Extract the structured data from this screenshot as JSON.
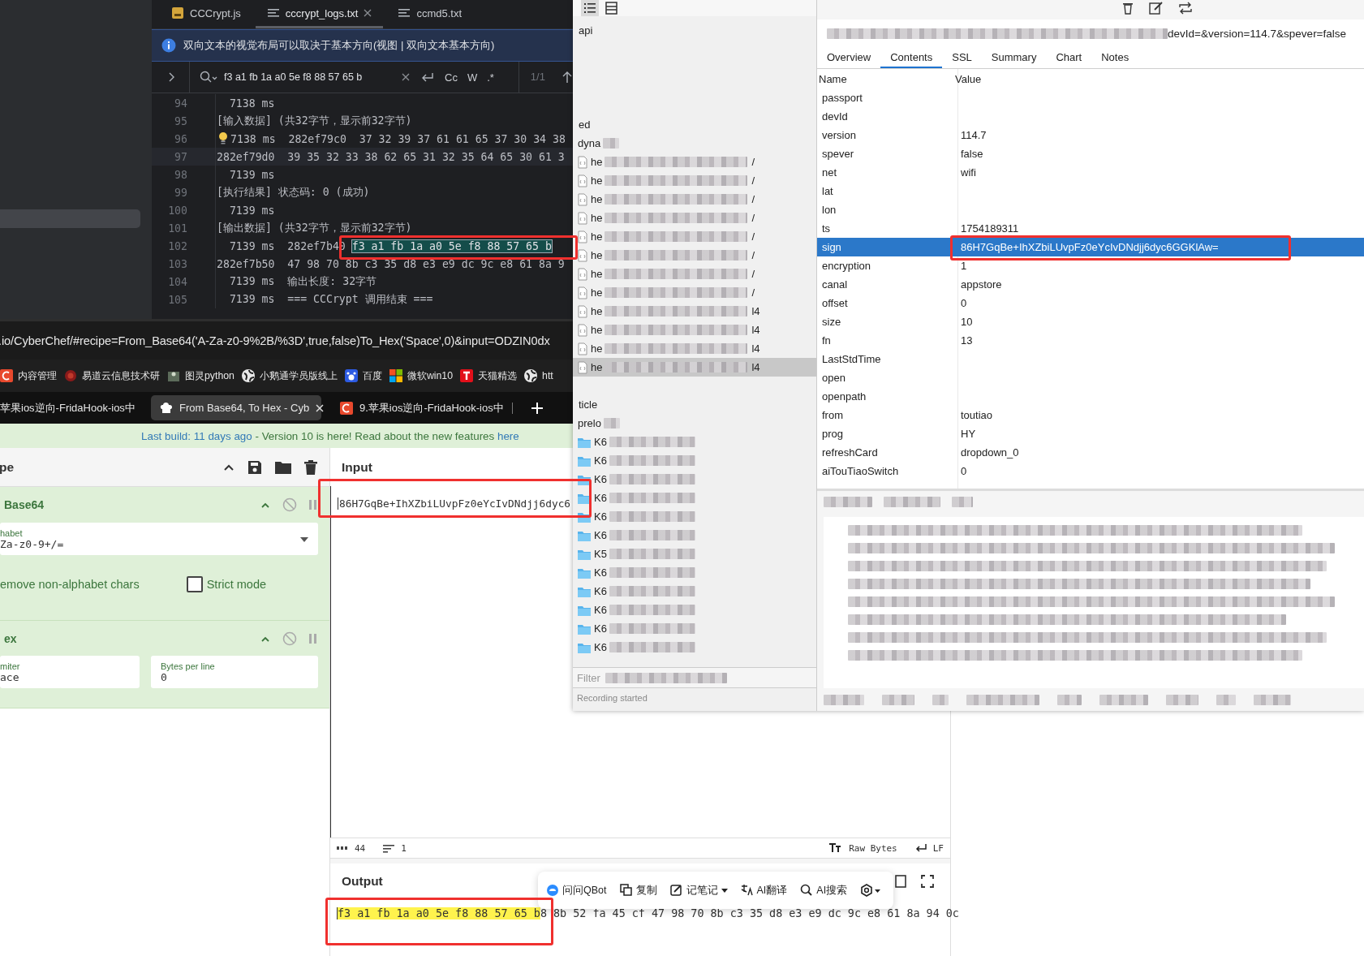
{
  "editor": {
    "tabs": [
      {
        "label": "CCCrypt.js",
        "kind": "js",
        "selected": false
      },
      {
        "label": "cccrypt_logs.txt",
        "kind": "text",
        "selected": true
      },
      {
        "label": "ccmd5.txt",
        "kind": "text",
        "selected": false
      }
    ],
    "info_bar": "双向文本的视觉布局可以取决于基本方向(视图 | 双向文本基本方向)",
    "find": {
      "value": "f3 a1 fb 1a a0 5e f8 88 57 65 b",
      "toggles": [
        "Cc",
        "W",
        ".*"
      ],
      "count": "1/1"
    },
    "lines": [
      {
        "number": "94",
        "text": "  7138 ms",
        "current": false,
        "hint": false
      },
      {
        "number": "95",
        "text": "[输入数据] (共32字节，显示前32字节)",
        "current": false,
        "hint": false
      },
      {
        "number": "96",
        "text": "7138 ms  282ef79c0  37 32 39 37 61 61 65 37 30 34 38",
        "current": false,
        "hint": true
      },
      {
        "number": "97",
        "text": "282ef79d0  39 35 32 33 38 62 65 31 32 35 64 65 30 61 3",
        "current": true,
        "hint": false
      },
      {
        "number": "98",
        "text": "  7139 ms",
        "current": false,
        "hint": false
      },
      {
        "number": "99",
        "text": "[执行结果] 状态码: 0 (成功)",
        "current": false,
        "hint": false
      },
      {
        "number": "100",
        "text": "  7139 ms",
        "current": false,
        "hint": false
      },
      {
        "number": "101",
        "text": "[输出数据] (共32字节，显示前32字节)",
        "current": false,
        "hint": false
      },
      {
        "number": "102",
        "text": "  7139 ms  282ef7b40 ",
        "match": "f3 a1 fb 1a a0 5e f8 88 57 65 b",
        "current": false,
        "hint": false
      },
      {
        "number": "103",
        "text": "282ef7b50  47 98 70 8b c3 35 d8 e3 e9 dc 9c e8 61 8a 9",
        "current": false,
        "hint": false
      },
      {
        "number": "104",
        "text": "  7139 ms  输出长度: 32字节",
        "current": false,
        "hint": false
      },
      {
        "number": "105",
        "text": "  7139 ms  === CCCrypt 调用结束 ===",
        "current": false,
        "hint": false
      }
    ]
  },
  "browser": {
    "url": ".io/CyberChef/#recipe=From_Base64('A-Za-z0-9%2B/%3D',true,false)To_Hex('Space',0)&input=ODZIN0dx",
    "bookmarks": [
      {
        "label": "内容管理",
        "kind": "c-logo"
      },
      {
        "label": "易道云信息技术研",
        "kind": "seal"
      },
      {
        "label": "图灵python",
        "kind": "figure"
      },
      {
        "label": "小鹅通学员版线上",
        "kind": "globe"
      },
      {
        "label": "百度",
        "kind": "paw"
      },
      {
        "label": "微软win10",
        "kind": "windows"
      },
      {
        "label": "天猫精选",
        "kind": "t-logo"
      },
      {
        "label": "htt",
        "kind": "globe"
      }
    ],
    "tabs": [
      {
        "label": "苹果ios逆向-FridaHook-ios中",
        "kind": "none",
        "selected": false
      },
      {
        "label": "From Base64, To Hex - Cyb",
        "kind": "chef",
        "selected": true
      },
      {
        "label": "9.苹果ios逆向-FridaHook-ios中",
        "kind": "c-logo",
        "selected": false
      }
    ],
    "banner": [
      {
        "text": "Last build: 11 days ago",
        "link": true
      },
      {
        "text": " - Version 10 is here! Read about the new features ",
        "link": false
      },
      {
        "text": "here",
        "link": true
      }
    ]
  },
  "cyberchef": {
    "recipe_title": "pe",
    "operations": [
      {
        "name": "Base64",
        "args": [
          {
            "kind": "select",
            "label": "habet",
            "value": "Za-z0-9+/="
          },
          {
            "kind": "text-only",
            "label": "emove non-alphabet chars"
          },
          {
            "kind": "checkbox",
            "label": "Strict mode",
            "checked": false
          }
        ]
      },
      {
        "name": "ex",
        "args": [
          {
            "kind": "field",
            "label": "miter",
            "value": "ace"
          },
          {
            "kind": "field",
            "label": "Bytes per line",
            "value": "0"
          }
        ]
      }
    ],
    "input": {
      "title": "Input",
      "value": "86H7GqBe+IhXZbiLUvpFz0eYcIvDNdjj6dyc6"
    },
    "status": {
      "length": "44",
      "lines": "1",
      "format": "Raw Bytes",
      "eol": "LF"
    },
    "output": {
      "title": "Output",
      "match": "f3 a1 fb 1a a0 5e f8 88 57 65 b",
      "rest": "8 8b 52 fa 45 cf 47 98 70 8b c3 35 d8 e3 e9 dc 9c e8 61 8a 94 0c"
    },
    "popup": [
      {
        "label": "问问QBot",
        "kind": "bot"
      },
      {
        "label": "复制",
        "kind": "copy"
      },
      {
        "label": "记笔记",
        "kind": "note"
      },
      {
        "label": "AI翻译",
        "kind": "translate"
      },
      {
        "label": "AI搜索",
        "kind": "search"
      }
    ]
  },
  "charles": {
    "tree": [
      {
        "label": "api",
        "kind": "group",
        "selected": false
      },
      {
        "label": "ed",
        "kind": "group",
        "selected": false
      },
      {
        "label": "dyna",
        "kind": "host",
        "selected": false
      },
      {
        "label": "he",
        "kind": "file",
        "tail": "/",
        "selected": false
      },
      {
        "label": "he",
        "kind": "file",
        "tail": "/",
        "selected": false
      },
      {
        "label": "he",
        "kind": "file",
        "tail": "/",
        "selected": false
      },
      {
        "label": "he",
        "kind": "file",
        "tail": "/",
        "selected": false
      },
      {
        "label": "he",
        "kind": "file",
        "tail": "/",
        "selected": false
      },
      {
        "label": "he",
        "kind": "file",
        "tail": "/",
        "selected": false
      },
      {
        "label": "he",
        "kind": "file",
        "tail": "/",
        "selected": false
      },
      {
        "label": "he",
        "kind": "file",
        "tail": "/",
        "selected": false
      },
      {
        "label": "he",
        "kind": "file",
        "tail": "l4",
        "selected": false
      },
      {
        "label": "he",
        "kind": "file",
        "tail": "l4",
        "selected": false
      },
      {
        "label": "he",
        "kind": "file",
        "tail": "l4",
        "selected": false
      },
      {
        "label": "he",
        "kind": "file",
        "tail": "l4",
        "selected": true
      },
      {
        "label": "ticle",
        "kind": "group",
        "selected": false
      },
      {
        "label": "prelo",
        "kind": "host",
        "selected": false
      },
      {
        "label": "K6",
        "kind": "folder",
        "selected": false
      },
      {
        "label": "K6",
        "kind": "folder",
        "selected": false
      },
      {
        "label": "K6",
        "kind": "folder",
        "selected": false
      },
      {
        "label": "K6",
        "kind": "folder",
        "selected": false
      },
      {
        "label": "K6",
        "kind": "folder",
        "selected": false
      },
      {
        "label": "K6",
        "kind": "folder",
        "selected": false
      },
      {
        "label": "K5",
        "kind": "folder",
        "selected": false
      },
      {
        "label": "K6",
        "kind": "folder",
        "selected": false
      },
      {
        "label": "K6",
        "kind": "folder",
        "selected": false
      },
      {
        "label": "K6",
        "kind": "folder",
        "selected": false
      },
      {
        "label": "K6",
        "kind": "folder",
        "selected": false
      },
      {
        "label": "K6",
        "kind": "folder",
        "selected": false
      }
    ],
    "filter": {
      "placeholder": "Filter"
    },
    "status": "Recording started",
    "url_tail": "devId=&version=114.7&spever=false",
    "tabs": [
      {
        "label": "Overview",
        "selected": false
      },
      {
        "label": "Contents",
        "selected": true
      },
      {
        "label": "SSL",
        "selected": false
      },
      {
        "label": "Summary",
        "selected": false
      },
      {
        "label": "Chart",
        "selected": false
      },
      {
        "label": "Notes",
        "selected": false
      }
    ],
    "columns": [
      "Name",
      "Value"
    ],
    "rows": [
      {
        "name": "passport",
        "value": "",
        "selected": false
      },
      {
        "name": "devId",
        "value": "",
        "selected": false
      },
      {
        "name": "version",
        "value": "114.7",
        "selected": false
      },
      {
        "name": "spever",
        "value": "false",
        "selected": false
      },
      {
        "name": "net",
        "value": "wifi",
        "selected": false
      },
      {
        "name": "lat",
        "value": "",
        "selected": false
      },
      {
        "name": "lon",
        "value": "",
        "selected": false
      },
      {
        "name": "ts",
        "value": "1754189311",
        "selected": false
      },
      {
        "name": "sign",
        "value": "86H7GqBe+IhXZbiLUvpFz0eYcIvDNdjj6dyc6GGKlAw=",
        "selected": true
      },
      {
        "name": "encryption",
        "value": "1",
        "selected": false
      },
      {
        "name": "canal",
        "value": "appstore",
        "selected": false
      },
      {
        "name": "offset",
        "value": "0",
        "selected": false
      },
      {
        "name": "size",
        "value": "10",
        "selected": false
      },
      {
        "name": "fn",
        "value": "13",
        "selected": false
      },
      {
        "name": "LastStdTime",
        "value": "",
        "selected": false
      },
      {
        "name": "open",
        "value": "",
        "selected": false
      },
      {
        "name": "openpath",
        "value": "",
        "selected": false
      },
      {
        "name": "from",
        "value": "toutiao",
        "selected": false
      },
      {
        "name": "prog",
        "value": "HY",
        "selected": false
      },
      {
        "name": "refreshCard",
        "value": "dropdown_0",
        "selected": false
      },
      {
        "name": "aiTouTiaoSwitch",
        "value": "0",
        "selected": false
      }
    ]
  }
}
